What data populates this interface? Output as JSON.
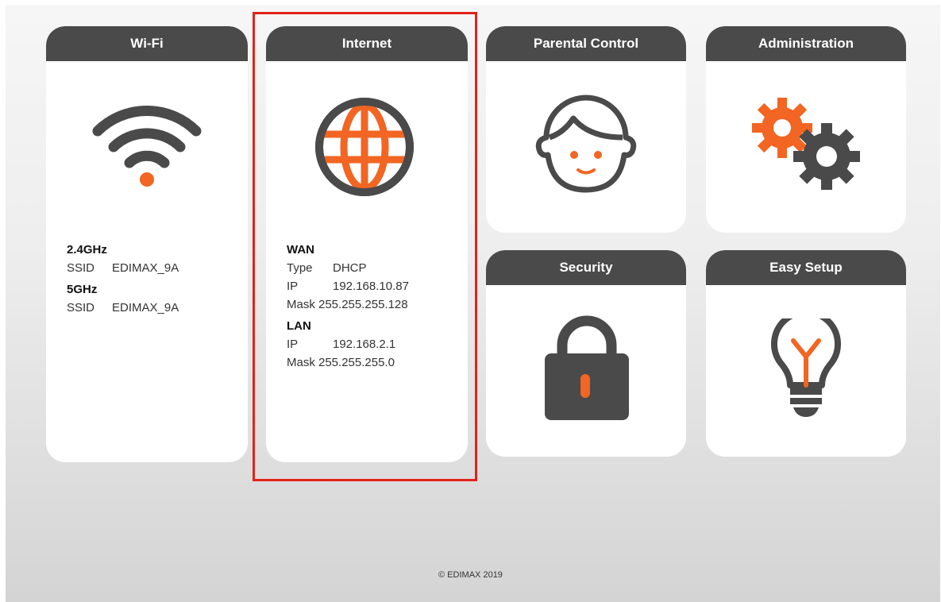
{
  "cards": {
    "wifi": {
      "title": "Wi-Fi",
      "band24_label": "2.4GHz",
      "band24_ssid_key": "SSID",
      "band24_ssid_value": "EDIMAX_9A",
      "band5_label": "5GHz",
      "band5_ssid_key": "SSID",
      "band5_ssid_value": "EDIMAX_9A"
    },
    "internet": {
      "title": "Internet",
      "wan_label": "WAN",
      "wan_type_key": "Type",
      "wan_type_value": "DHCP",
      "wan_ip_key": "IP",
      "wan_ip_value": "192.168.10.87",
      "wan_mask_key": "Mask",
      "wan_mask_value": "255.255.255.128",
      "lan_label": "LAN",
      "lan_ip_key": "IP",
      "lan_ip_value": "192.168.2.1",
      "lan_mask_key": "Mask",
      "lan_mask_value": "255.255.255.0"
    },
    "parental": {
      "title": "Parental Control"
    },
    "administration": {
      "title": "Administration"
    },
    "security": {
      "title": "Security"
    },
    "easy_setup": {
      "title": "Easy Setup"
    }
  },
  "icons": {
    "wifi": "wifi-icon",
    "internet": "globe-icon",
    "parental": "child-face-icon",
    "administration": "gears-icon",
    "security": "padlock-icon",
    "easy_setup": "lightbulb-icon"
  },
  "footer": {
    "copyright": "© EDIMAX 2019"
  },
  "colors": {
    "accent": "#f26522",
    "dark": "#4a4a4a",
    "highlight": "#e2231a"
  }
}
